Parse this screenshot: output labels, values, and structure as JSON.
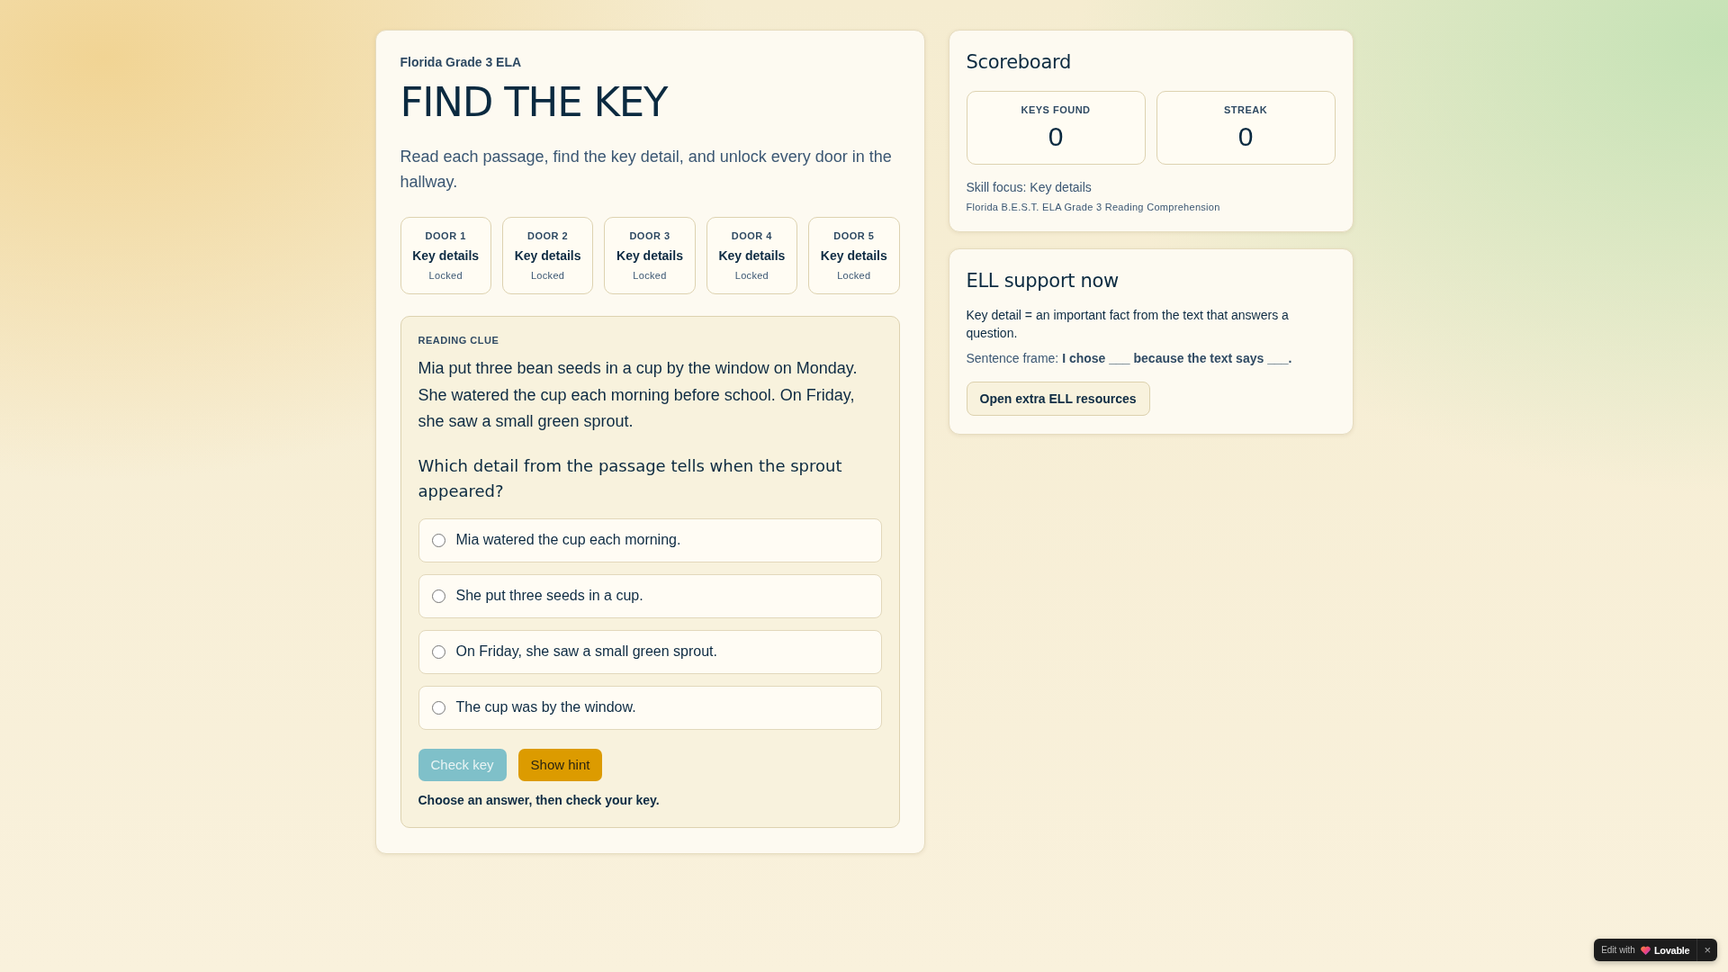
{
  "main": {
    "subject": "Florida Grade 3 ELA",
    "title": "FIND THE KEY",
    "intro": "Read each passage, find the key detail, and unlock every door in the hallway.",
    "doors": [
      {
        "label": "DOOR 1",
        "skill": "Key details",
        "status": "Locked"
      },
      {
        "label": "DOOR 2",
        "skill": "Key details",
        "status": "Locked"
      },
      {
        "label": "DOOR 3",
        "skill": "Key details",
        "status": "Locked"
      },
      {
        "label": "DOOR 4",
        "skill": "Key details",
        "status": "Locked"
      },
      {
        "label": "DOOR 5",
        "skill": "Key details",
        "status": "Locked"
      }
    ],
    "clue": {
      "heading": "READING CLUE",
      "passage": "Mia put three bean seeds in a cup by the window on Monday. She watered the cup each morning before school. On Friday, she saw a small green sprout.",
      "question": "Which detail from the passage tells when the sprout appeared?",
      "options": [
        {
          "text": "Mia watered the cup each morning.",
          "selected": false
        },
        {
          "text": "She put three seeds in a cup.",
          "selected": false
        },
        {
          "text": "On Friday, she saw a small green sprout.",
          "selected": false
        },
        {
          "text": "The cup was by the window.",
          "selected": false
        }
      ],
      "buttons": [
        {
          "label": "Check key",
          "kind": "primary",
          "disabled": true
        },
        {
          "label": "Show hint",
          "kind": "accent",
          "disabled": false
        }
      ],
      "feedback": "Choose an answer, then check your key."
    }
  },
  "scoreboard": {
    "title": "Scoreboard",
    "stats": [
      {
        "label": "KEYS FOUND",
        "value": "0"
      },
      {
        "label": "STREAK",
        "value": "0"
      }
    ],
    "skill_focus": "Skill focus: Key details",
    "standard": "Florida B.E.S.T. ELA Grade 3 Reading Comprehension"
  },
  "ell_support": {
    "title": "ELL support now",
    "definition": "Key detail = an important fact from the text that answers a question.",
    "sentence_frame": "Sentence frame: **I chose ___ because the text says ___.**",
    "button": "Open extra ELL resources"
  },
  "badge": {
    "prefix": "Edit with",
    "brand": "Lovable",
    "close": "×"
  }
}
